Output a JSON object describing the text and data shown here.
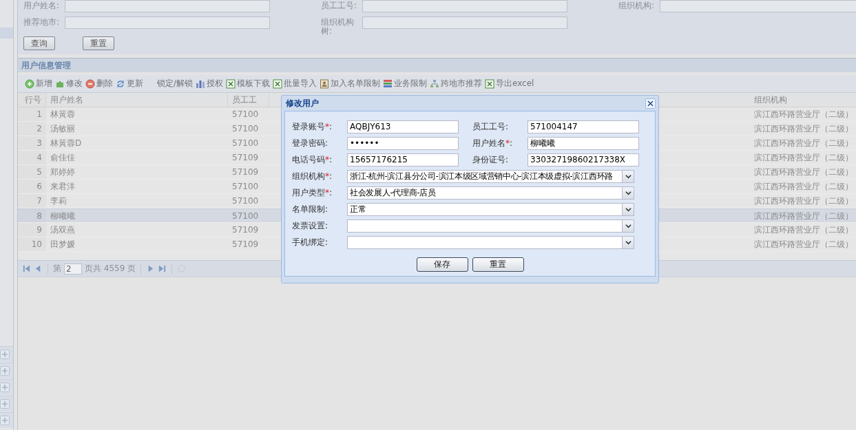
{
  "search_form": {
    "rows": [
      [
        {
          "label": "用户姓名:"
        },
        {
          "label": "员工工号:"
        },
        {
          "label": "组织机构:"
        }
      ],
      [
        {
          "label": "推荐地市:"
        },
        {
          "label": "组织机构树:"
        }
      ]
    ],
    "buttons": [
      "查询",
      "重置"
    ]
  },
  "panel": {
    "title": "用户信息管理"
  },
  "toolbar": [
    {
      "label": "新增"
    },
    {
      "label": "修改"
    },
    {
      "label": "删除"
    },
    {
      "label": "更新"
    },
    {
      "label": "锁定/解锁"
    },
    {
      "label": "授权"
    },
    {
      "label": "模板下载"
    },
    {
      "label": "批量导入"
    },
    {
      "label": "加入名单限制"
    },
    {
      "label": "业务限制"
    },
    {
      "label": "跨地市推荐"
    },
    {
      "label": "导出excel"
    }
  ],
  "table": {
    "columns": [
      "行号",
      "用户姓名",
      "员工工",
      "组织机构"
    ],
    "rows": [
      {
        "cells": [
          "1",
          "林黃蓉",
          "57100",
          "滨江西环路营业厅（二级）"
        ],
        "selected": false
      },
      {
        "cells": [
          "2",
          "汤敏丽",
          "57100",
          "滨江西环路营业厅（二级）"
        ],
        "selected": false
      },
      {
        "cells": [
          "3",
          "林黃蓉D",
          "57100",
          "滨江西环路营业厅（二级）"
        ],
        "selected": false
      },
      {
        "cells": [
          "4",
          "俞佳佳",
          "57109",
          "滨江西环路营业厅（二级）"
        ],
        "selected": false
      },
      {
        "cells": [
          "5",
          "郑婷婷",
          "57109",
          "滨江西环路营业厅（二级）"
        ],
        "selected": false
      },
      {
        "cells": [
          "6",
          "来君洋",
          "57100",
          "滨江西环路营业厅（二级）"
        ],
        "selected": false
      },
      {
        "cells": [
          "7",
          "李莉",
          "57100",
          "滨江西环路营业厅（二级）"
        ],
        "selected": false
      },
      {
        "cells": [
          "8",
          "柳曦曦",
          "57100",
          "滨江西环路营业厅（二级）"
        ],
        "selected": true
      },
      {
        "cells": [
          "9",
          "汤双燕",
          "57109",
          "滨江西环路营业厅（二级）"
        ],
        "selected": false
      },
      {
        "cells": [
          "10",
          "田梦媛",
          "57109",
          "滨江西环路营业厅（二级）"
        ],
        "selected": false
      }
    ]
  },
  "pager": {
    "before": "第",
    "page": "2",
    "after": "页共 4559 页"
  },
  "dialog": {
    "title": "修改用户",
    "required_mark": "*",
    "label_suffix": ":",
    "pairs": [
      [
        {
          "label": "登录账号",
          "required": true,
          "value": "AQBJY613"
        },
        {
          "label": "员工工号",
          "required": false,
          "value": "571004147"
        }
      ],
      [
        {
          "label": "登录密码",
          "required": false,
          "value": "••••••"
        },
        {
          "label": "用户姓名",
          "required": true,
          "value": "柳曦曦"
        }
      ],
      [
        {
          "label": "电话号码",
          "required": true,
          "value": "15657176215"
        },
        {
          "label": "身份证号",
          "required": false,
          "value": "33032719860217338X"
        }
      ]
    ],
    "selects": [
      {
        "label": "组织机构",
        "required": true,
        "value": "浙江-杭州-滨江县分公司-滨江本级区域营销中心-滨江本级虚拟-滨江西环路"
      },
      {
        "label": "用户类型",
        "required": true,
        "value": "社会发展人-代理商-店员"
      },
      {
        "label": "名单限制",
        "required": false,
        "value": "正常"
      },
      {
        "label": "发票设置",
        "required": false
      },
      {
        "label": "手机绑定",
        "required": false
      }
    ],
    "buttons": [
      "保存",
      "重置"
    ]
  }
}
